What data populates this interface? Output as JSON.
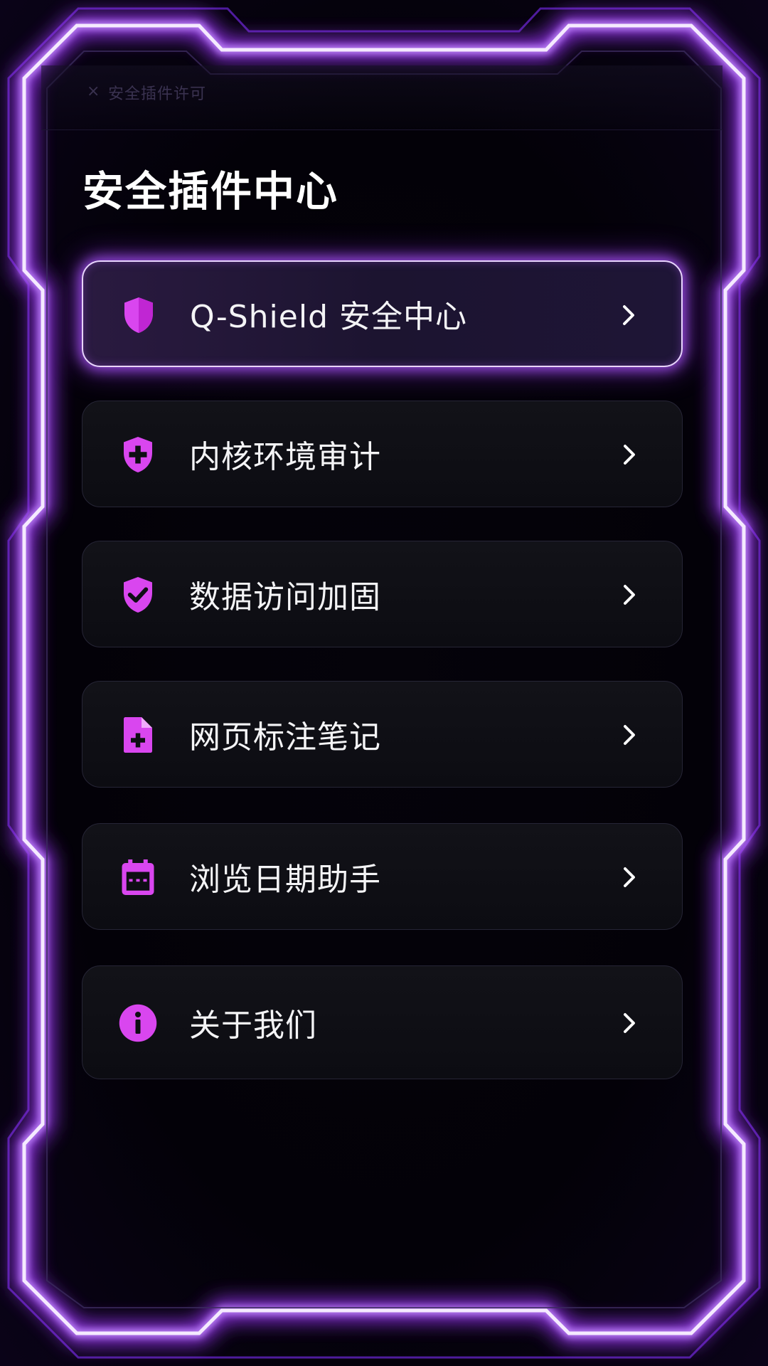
{
  "colors": {
    "accent": "#a855f7",
    "icon": "#d946ef",
    "frame_glow": "#9333ea",
    "frame_core": "#f3e8ff",
    "background": "#000000",
    "text": "#ffffff"
  },
  "topbar": {
    "close_glyph": "×",
    "title": "安全插件许可"
  },
  "page_title": "安全插件中心",
  "menu": {
    "items": [
      {
        "label": "Q-Shield 安全中心",
        "icon": "shield-icon",
        "active": true
      },
      {
        "label": "内核环境审计",
        "icon": "shield-plus-icon",
        "active": false
      },
      {
        "label": "数据访问加固",
        "icon": "shield-check-icon",
        "active": false
      },
      {
        "label": "网页标注笔记",
        "icon": "file-plus-icon",
        "active": false
      },
      {
        "label": "浏览日期助手",
        "icon": "calendar-icon",
        "active": false
      },
      {
        "label": "关于我们",
        "icon": "info-icon",
        "active": false
      }
    ]
  }
}
